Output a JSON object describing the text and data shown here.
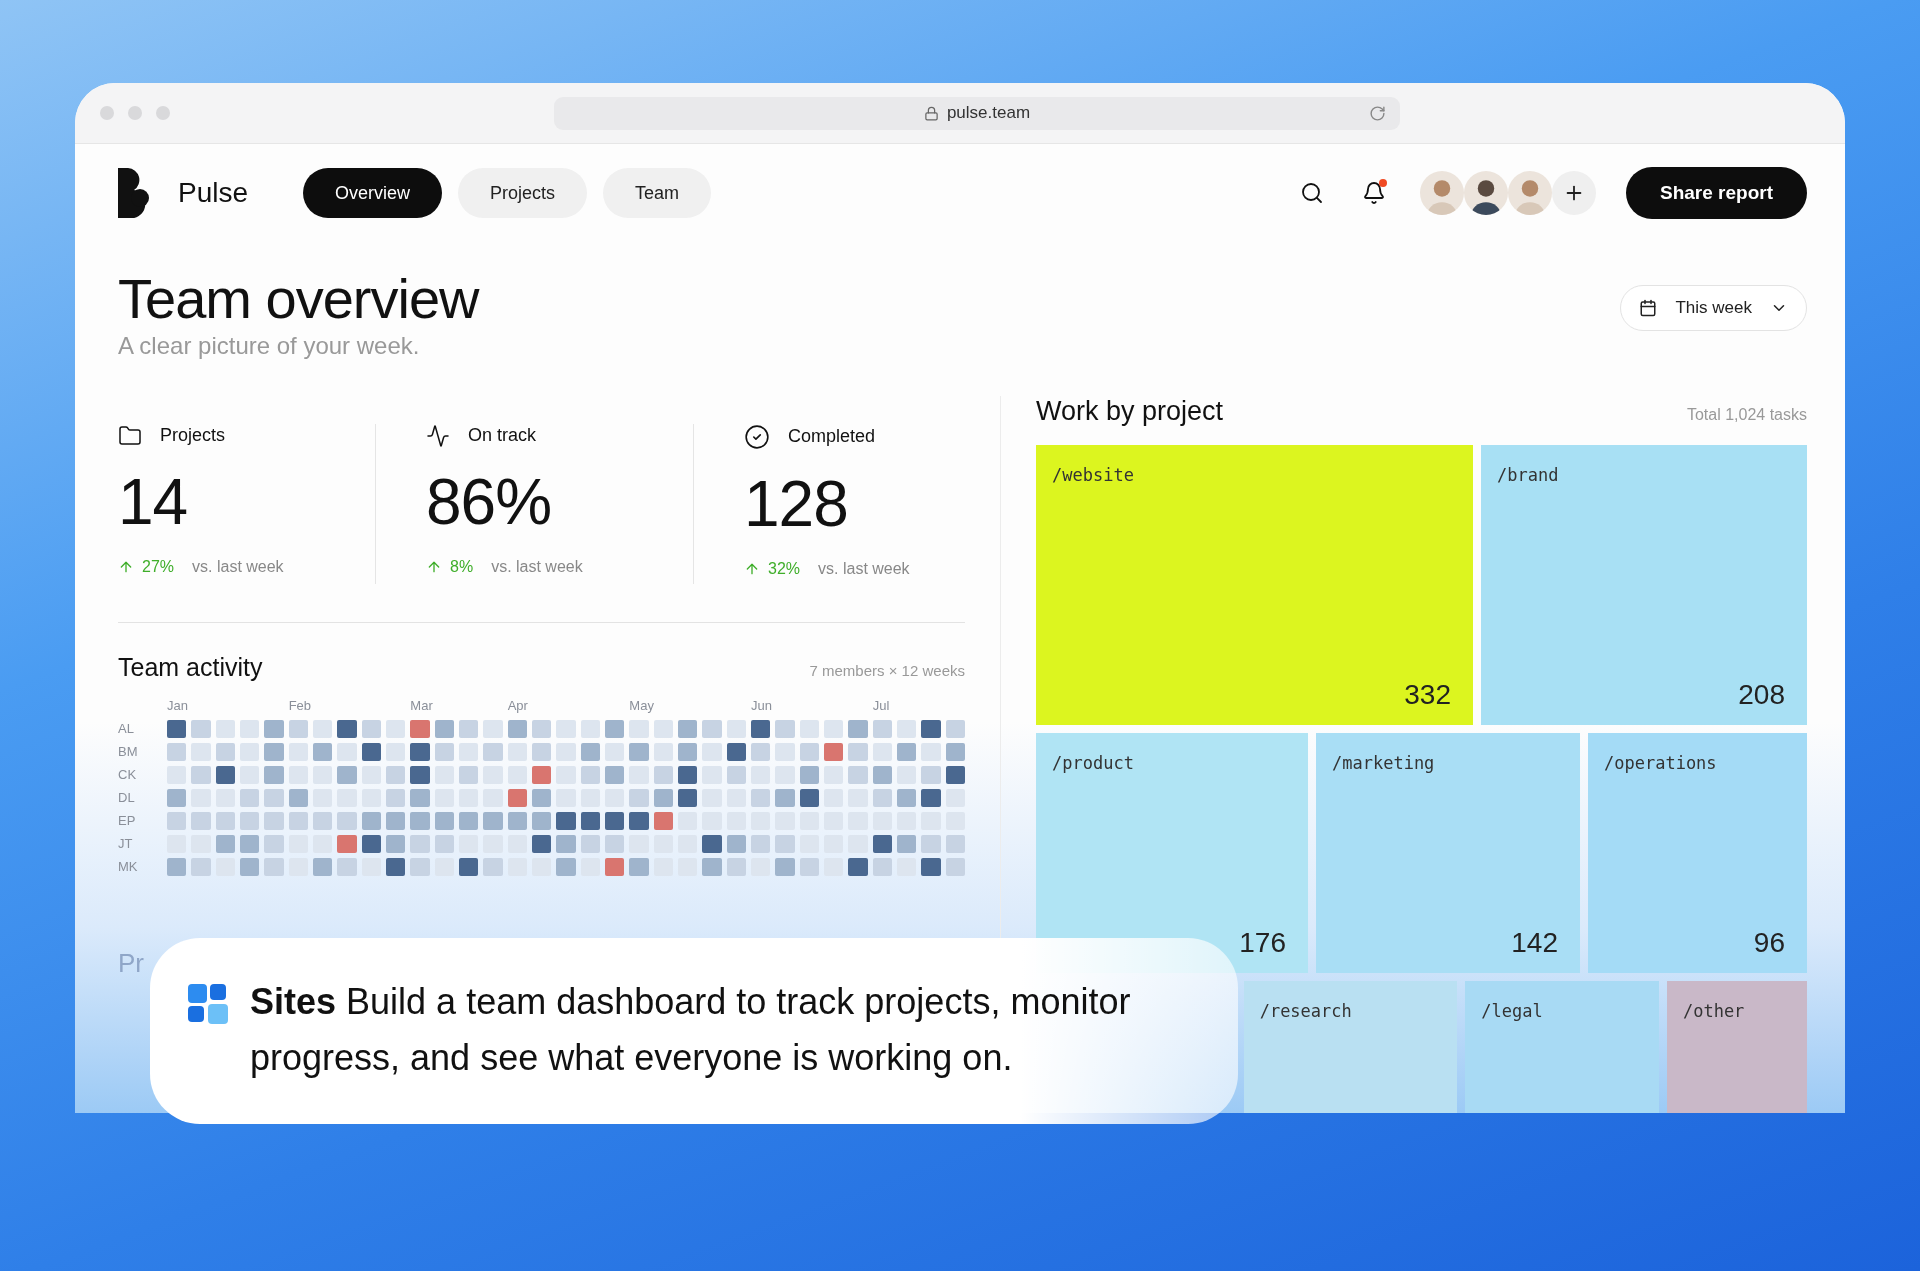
{
  "browser": {
    "url": "pulse.team"
  },
  "app": {
    "name": "Pulse"
  },
  "nav_tabs": [
    {
      "label": "Overview",
      "selected": true
    },
    {
      "label": "Projects",
      "selected": false
    },
    {
      "label": "Team",
      "selected": false
    }
  ],
  "notifications": {
    "unread": true
  },
  "share_button": "Share report",
  "header": {
    "title": "Team overview",
    "subtitle": "A clear picture of your week."
  },
  "period_dropdown": "This week",
  "stats": [
    {
      "kind": "folder",
      "label": "Projects",
      "value": "14",
      "change": "27%",
      "compare": "vs. last week"
    },
    {
      "kind": "pulse",
      "label": "On track",
      "value": "86%",
      "change": "8%",
      "compare": "vs. last week"
    },
    {
      "kind": "check",
      "label": "Completed",
      "value": "128",
      "change": "32%",
      "compare": "vs. last week"
    }
  ],
  "team_activity": {
    "title": "Team activity",
    "meta": "7 members × 12 weeks",
    "months": [
      "Jan",
      "Feb",
      "Mar",
      "Apr",
      "May",
      "Jun",
      "Jul"
    ],
    "members": [
      "AL",
      "BM",
      "CK",
      "DL",
      "EP",
      "JT",
      "MK"
    ]
  },
  "next_section_title": "Pr",
  "work_by_project": {
    "title": "Work by project",
    "total": "Total 1,024 tasks",
    "rows": [
      [
        {
          "label": "/website",
          "count": "332",
          "color": "#dcf51f"
        },
        {
          "label": "/brand",
          "count": "208",
          "color": "#a8e0f4"
        }
      ],
      [
        {
          "label": "/product",
          "count": "176",
          "color": "#b0e4f4"
        },
        {
          "label": "/marketing",
          "count": "142",
          "color": "#a9def5"
        },
        {
          "label": "/operations",
          "count": "96",
          "color": "#a4dbf6"
        }
      ],
      [
        {
          "label": "/research",
          "color": "#b9e0f2"
        },
        {
          "label": "/legal",
          "color": "#a8daf4"
        },
        {
          "label": "/other",
          "color": "#c9b8c8"
        }
      ]
    ]
  },
  "caption": {
    "text": "**Sites**  Build a team dashboard to track projects, monitor progress, and see what everyone is working on."
  }
}
